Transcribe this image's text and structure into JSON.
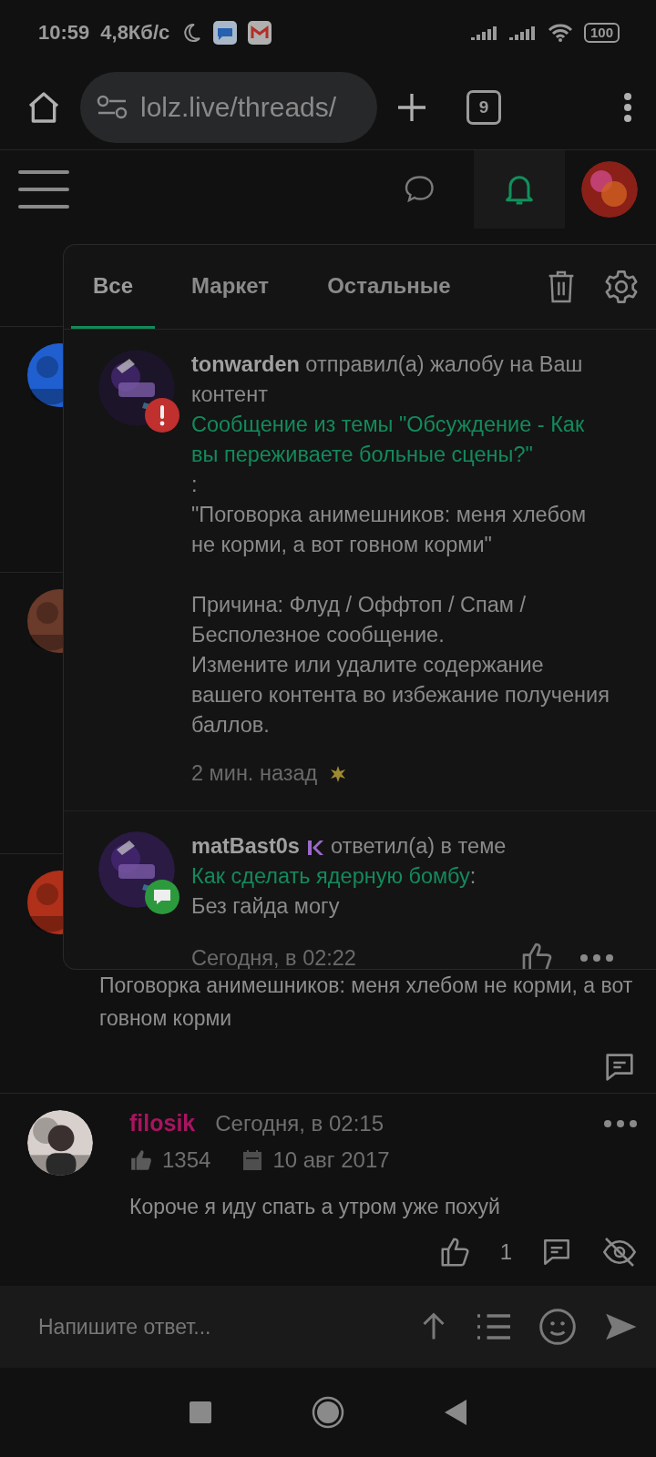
{
  "status_bar": {
    "time": "10:59",
    "speed": "4,8Кб/с",
    "battery": "100"
  },
  "browser": {
    "url": "lolz.live/threads/",
    "tab_count": "9"
  },
  "header": {
    "bell_selected": true
  },
  "posts": [
    {
      "kind": "covered"
    },
    {
      "kind": "covered"
    },
    {
      "kind": "covered",
      "text": "Поговорка анимешников: меня хлебом не корми, а вот говном корми"
    },
    {
      "kind": "full",
      "author": "filosik",
      "time": "Сегодня, в 02:15",
      "likes": "1354",
      "joined": "10 авг 2017",
      "text": "Короче я иду спать а утром уже похуй",
      "like_count": "1"
    }
  ],
  "notifications": {
    "tabs": [
      {
        "label": "Все",
        "selected": true
      },
      {
        "label": "Маркет",
        "selected": false
      },
      {
        "label": "Остальные",
        "selected": false
      }
    ],
    "items": [
      {
        "kind": "report",
        "user": "tonwarden",
        "action": "отправил(а) жалобу на Ваш контент",
        "link": "Сообщение из темы \"Обсуждение - Как вы переживаете больные сцены?\"",
        "after": ":",
        "body": [
          "\"Поговорка анимешников: меня хлебом не корми, а вот говном корми\"",
          "Причина: Флуд / Оффтоп / Спам / Бесполезное сообщение.\nИзмените или удалите содержание вашего контента во избежание получения баллов."
        ],
        "time": "2 мин. назад",
        "unread": true
      },
      {
        "kind": "reply",
        "user": "matBast0s",
        "action": "ответил(а) в теме",
        "link": "Как сделать ядерную бомбу",
        "after": ":",
        "body": [
          "Без гайда могу"
        ],
        "time": "Сегодня, в 02:22",
        "unread": false
      }
    ]
  },
  "composer": {
    "placeholder": "Напишите ответ..."
  }
}
